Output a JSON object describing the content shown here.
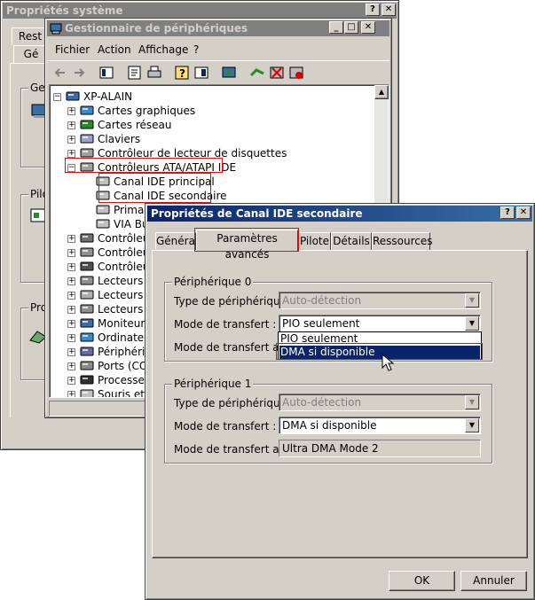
{
  "sysprops": {
    "title": "Propriétés système",
    "tab_fragments": [
      "Rest",
      "Gé"
    ],
    "group_fragments": [
      "Ges",
      "Pilo",
      "Pro"
    ]
  },
  "devmgr": {
    "title": "Gestionnaire de périphériques",
    "menu": [
      "Fichier",
      "Action",
      "Affichage",
      "?"
    ],
    "tree": [
      {
        "label": "XP-ALAIN",
        "level": 0,
        "expander": "minus",
        "icon": "computer-icon"
      },
      {
        "label": "Cartes graphiques",
        "level": 1,
        "expander": "plus",
        "icon": "display-adapter-icon"
      },
      {
        "label": "Cartes réseau",
        "level": 1,
        "expander": "plus",
        "icon": "network-card-icon"
      },
      {
        "label": "Claviers",
        "level": 1,
        "expander": "plus",
        "icon": "keyboard-icon"
      },
      {
        "label": "Contrôleur de lecteur de disquettes",
        "level": 1,
        "expander": "plus",
        "icon": "floppy-controller-icon"
      },
      {
        "label": "Contrôleurs ATA/ATAPI IDE",
        "level": 1,
        "expander": "minus",
        "icon": "ide-controller-icon"
      },
      {
        "label": "Canal IDE principal",
        "level": 2,
        "expander": "",
        "icon": "ide-channel-icon"
      },
      {
        "label": "Canal IDE secondaire",
        "level": 2,
        "expander": "",
        "icon": "ide-channel-icon"
      },
      {
        "label": "Primar",
        "level": 2,
        "expander": "",
        "icon": "ide-channel-icon"
      },
      {
        "label": "VIA Bu",
        "level": 2,
        "expander": "",
        "icon": "ide-channel-icon"
      },
      {
        "label": "Contrôleur",
        "level": 1,
        "expander": "plus",
        "icon": "sound-controller-icon"
      },
      {
        "label": "Contrôleur",
        "level": 1,
        "expander": "plus",
        "icon": "controller-icon"
      },
      {
        "label": "Contrôleur",
        "level": 1,
        "expander": "plus",
        "icon": "usb-controller-icon"
      },
      {
        "label": "Lecteurs d",
        "level": 1,
        "expander": "plus",
        "icon": "disk-drive-icon"
      },
      {
        "label": "Lecteurs d",
        "level": 1,
        "expander": "plus",
        "icon": "cdrom-drive-icon"
      },
      {
        "label": "Lecteurs d",
        "level": 1,
        "expander": "plus",
        "icon": "drive-icon"
      },
      {
        "label": "Moniteurs",
        "level": 1,
        "expander": "plus",
        "icon": "monitor-icon"
      },
      {
        "label": "Ordinateur",
        "level": 1,
        "expander": "plus",
        "icon": "computer-small-icon"
      },
      {
        "label": "Périphériqu",
        "level": 1,
        "expander": "plus",
        "icon": "peripheral-icon"
      },
      {
        "label": "Ports (CON",
        "level": 1,
        "expander": "plus",
        "icon": "port-icon"
      },
      {
        "label": "Processeur",
        "level": 1,
        "expander": "plus",
        "icon": "processor-icon"
      },
      {
        "label": "Souris et a",
        "level": 1,
        "expander": "plus",
        "icon": "mouse-icon"
      }
    ]
  },
  "ideprops": {
    "title": "Propriétés de Canal IDE secondaire",
    "tabs": [
      "Général",
      "Paramètres avancés",
      "Pilote",
      "Détails",
      "Ressources"
    ],
    "device0": {
      "title": "Périphérique 0",
      "type_label": "Type de périphérique :",
      "type_value": "Auto-détection",
      "mode_label": "Mode de transfert :",
      "mode_value": "PIO seulement",
      "active_label": "Mode de transfert actif :",
      "dropdown_options": [
        "PIO seulement",
        "DMA si disponible"
      ]
    },
    "device1": {
      "title": "Périphérique 1",
      "type_label": "Type de périphérique :",
      "type_value": "Auto-détection",
      "mode_label": "Mode de transfert :",
      "mode_value": "DMA si disponible",
      "active_label": "Mode de transfert actif :",
      "active_value": "Ultra DMA Mode 2"
    },
    "ok_label": "OK",
    "cancel_label": "Annuler"
  },
  "colors": {
    "active_title": "#0a246a",
    "inactive_title": "#808080",
    "selection": "#0a246a",
    "highlight_box": "#e01010",
    "face": "#d4d0c8"
  }
}
